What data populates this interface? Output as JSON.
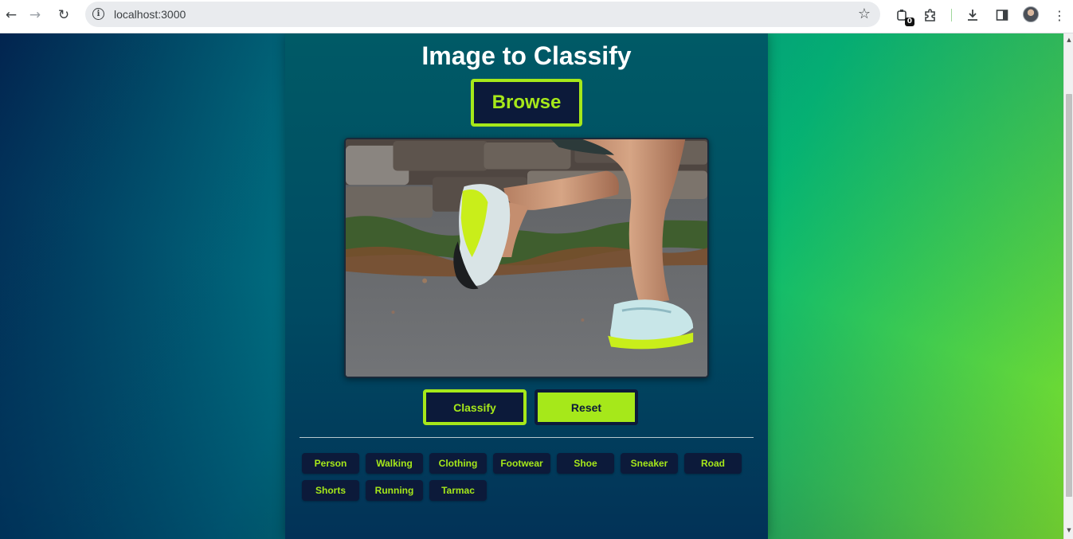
{
  "browser": {
    "url": "localhost:3000",
    "extensions_badge": "0",
    "icons": {
      "back": "back-arrow-icon",
      "forward": "forward-arrow-icon",
      "reload": "reload-icon",
      "site_info": "info-icon",
      "bookmark": "star-icon",
      "extension": "puzzle-icon",
      "downloads": "download-icon",
      "side_panel": "side-panel-icon",
      "menu": "kebab-menu-icon"
    }
  },
  "app": {
    "title": "Image to Classify",
    "browse_label": "Browse",
    "preview_image": "photo of a runner's legs wearing neon yellow-green running shoes on asphalt",
    "classify_label": "Classify",
    "reset_label": "Reset",
    "tags": [
      "Person",
      "Walking",
      "Clothing",
      "Footwear",
      "Shoe",
      "Sneaker",
      "Road",
      "Shorts",
      "Running",
      "Tarmac"
    ]
  },
  "colors": {
    "accent": "#a6e81a",
    "dark_navy": "#0c1a3a",
    "panel": "#004a62"
  }
}
